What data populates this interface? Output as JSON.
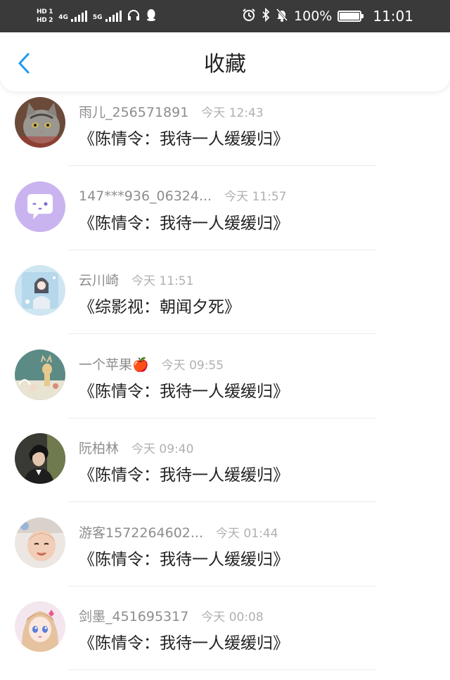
{
  "status_bar": {
    "hd1": "HD 1",
    "hd2": "HD 2",
    "net1": "4G",
    "net2": "5G",
    "battery": "100%",
    "time": "11:01",
    "icons": [
      "headphones-icon",
      "qq-icon",
      "alarm-icon",
      "bluetooth-icon",
      "mute-bell-icon"
    ]
  },
  "header": {
    "title": "收藏",
    "accent": "#1a9bf0"
  },
  "items": [
    {
      "name": "雨儿_256571891",
      "time": "今天 12:43",
      "book": "《陈情令：我待一人缓缓归》",
      "avatar": "cat"
    },
    {
      "name": "147***936_06324...",
      "time": "今天 11:57",
      "book": "《陈情令：我待一人缓缓归》",
      "avatar": "chat"
    },
    {
      "name": "云川崎",
      "time": "今天 11:51",
      "book": "《综影视：朝闻夕死》",
      "avatar": "girl-blue"
    },
    {
      "name": "一个苹果🍎",
      "time": "今天 09:55",
      "book": "《陈情令：我待一人缓缓归》",
      "avatar": "deer"
    },
    {
      "name": "阮柏林",
      "time": "今天 09:40",
      "book": "《陈情令：我待一人缓缓归》",
      "avatar": "boy-dark"
    },
    {
      "name": "游客1572264602...",
      "time": "今天 01:44",
      "book": "《陈情令：我待一人缓缓归》",
      "avatar": "baby"
    },
    {
      "name": "剑墨_451695317",
      "time": "今天 00:08",
      "book": "《陈情令：我待一人缓缓归》",
      "avatar": "anime-girl"
    }
  ]
}
